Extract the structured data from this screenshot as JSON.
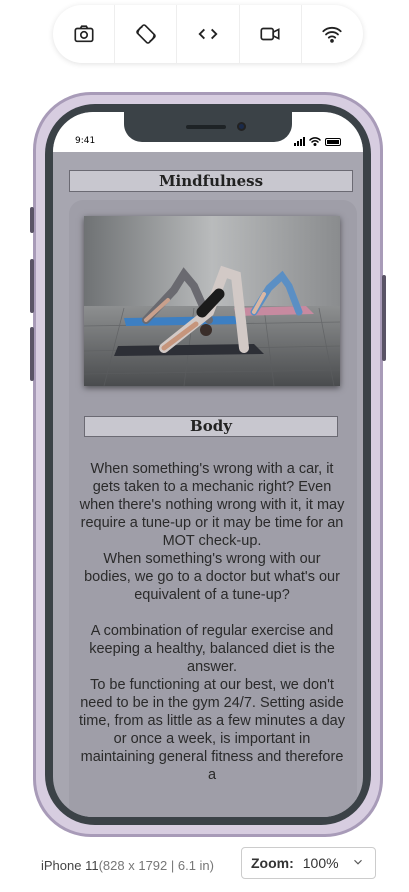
{
  "toolbar": {
    "buttons": [
      {
        "icon": "camera-icon"
      },
      {
        "icon": "rotate-icon"
      },
      {
        "icon": "code-icon"
      },
      {
        "icon": "video-icon"
      },
      {
        "icon": "wifi-icon"
      }
    ]
  },
  "status_bar": {
    "time": "9:41"
  },
  "page": {
    "title": "Mindfulness",
    "section_title": "Body",
    "paragraphs": [
      "When something's wrong with a car, it gets taken to a mechanic right? Even when there's nothing wrong with it, it may require a tune-up or it may be time for an MOT check-up.\nWhen something's wrong with our bodies, we go to a doctor but what's our equivalent of a tune-up?",
      "A combination of regular exercise and keeping a healthy, balanced diet is the answer.\nTo be functioning at our best, we don't need to be in the gym 24/7. Setting aside time, from as little as a few minutes a day or once a week, is important in maintaining general fitness and therefore a"
    ]
  },
  "device": {
    "name": "iPhone 11",
    "dims": "(828 x 1792 | 6.1 in)"
  },
  "zoom": {
    "label": "Zoom:",
    "value": "100%"
  },
  "colors": {
    "screen_bg": "#a7a6b0",
    "frame": "#d7cde0",
    "accent": "#2d4d8f"
  }
}
